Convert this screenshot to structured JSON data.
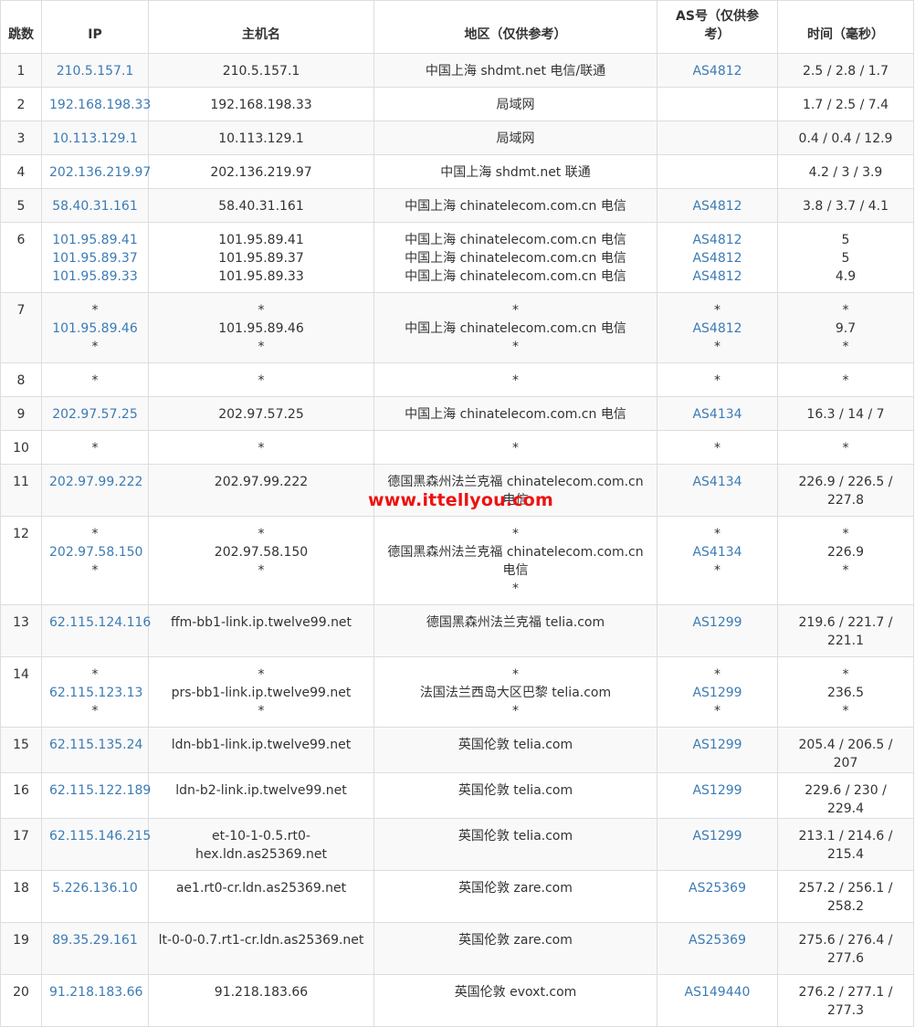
{
  "headers": {
    "hop": "跳数",
    "ip": "IP",
    "host": "主机名",
    "region": "地区（仅供参考）",
    "asn": "AS号（仅供参考）",
    "time": "时间（毫秒）"
  },
  "watermark": "www.ittellyou.com",
  "rows": [
    {
      "hop": "1",
      "ip": [
        "210.5.157.1"
      ],
      "host": [
        "210.5.157.1"
      ],
      "region": [
        "中国上海 shdmt.net 电信/联通"
      ],
      "asn": [
        "AS4812"
      ],
      "time": [
        "2.5 / 2.8 / 1.7"
      ]
    },
    {
      "hop": "2",
      "ip": [
        "192.168.198.33"
      ],
      "host": [
        "192.168.198.33"
      ],
      "region": [
        "局域网"
      ],
      "asn": [
        ""
      ],
      "time": [
        "1.7 / 2.5 / 7.4"
      ]
    },
    {
      "hop": "3",
      "ip": [
        "10.113.129.1"
      ],
      "host": [
        "10.113.129.1"
      ],
      "region": [
        "局域网"
      ],
      "asn": [
        ""
      ],
      "time": [
        "0.4 / 0.4 / 12.9"
      ]
    },
    {
      "hop": "4",
      "ip": [
        "202.136.219.97"
      ],
      "host": [
        "202.136.219.97"
      ],
      "region": [
        "中国上海 shdmt.net 联通"
      ],
      "asn": [
        ""
      ],
      "time": [
        "4.2 / 3 / 3.9"
      ]
    },
    {
      "hop": "5",
      "ip": [
        "58.40.31.161"
      ],
      "host": [
        "58.40.31.161"
      ],
      "region": [
        "中国上海 chinatelecom.com.cn 电信"
      ],
      "asn": [
        "AS4812"
      ],
      "time": [
        "3.8 / 3.7 / 4.1"
      ]
    },
    {
      "hop": "6",
      "ip": [
        "101.95.89.41",
        "101.95.89.37",
        "101.95.89.33"
      ],
      "host": [
        "101.95.89.41",
        "101.95.89.37",
        "101.95.89.33"
      ],
      "region": [
        "中国上海 chinatelecom.com.cn 电信",
        "中国上海 chinatelecom.com.cn 电信",
        "中国上海 chinatelecom.com.cn 电信"
      ],
      "asn": [
        "AS4812",
        "AS4812",
        "AS4812"
      ],
      "time": [
        "5",
        "5",
        "4.9"
      ]
    },
    {
      "hop": "7",
      "ip": [
        "*",
        "101.95.89.46",
        "*"
      ],
      "host": [
        "*",
        "101.95.89.46",
        "*"
      ],
      "region": [
        "*",
        "中国上海 chinatelecom.com.cn 电信",
        "*"
      ],
      "asn": [
        "*",
        "AS4812",
        "*"
      ],
      "time": [
        "*",
        "9.7",
        "*"
      ]
    },
    {
      "hop": "8",
      "ip": [
        "*"
      ],
      "host": [
        "*"
      ],
      "region": [
        "*"
      ],
      "asn": [
        "*"
      ],
      "time": [
        "*"
      ]
    },
    {
      "hop": "9",
      "ip": [
        "202.97.57.25"
      ],
      "host": [
        "202.97.57.25"
      ],
      "region": [
        "中国上海 chinatelecom.com.cn 电信"
      ],
      "asn": [
        "AS4134"
      ],
      "time": [
        "16.3 / 14 / 7"
      ]
    },
    {
      "hop": "10",
      "ip": [
        "*"
      ],
      "host": [
        "*"
      ],
      "region": [
        "*"
      ],
      "asn": [
        "*"
      ],
      "time": [
        "*"
      ]
    },
    {
      "hop": "11",
      "ip": [
        "202.97.99.222"
      ],
      "host": [
        "202.97.99.222"
      ],
      "region": [
        "德国黑森州法兰克福 chinatelecom.com.cn 电信"
      ],
      "asn": [
        "AS4134"
      ],
      "time": [
        "226.9 / 226.5 / 227.8"
      ]
    },
    {
      "hop": "12",
      "ip": [
        "*",
        "202.97.58.150",
        "*"
      ],
      "host": [
        "*",
        "202.97.58.150",
        "*"
      ],
      "region": [
        "*",
        "德国黑森州法兰克福 chinatelecom.com.cn 电信",
        "*"
      ],
      "asn": [
        "*",
        "AS4134",
        "*"
      ],
      "time": [
        "*",
        "226.9",
        "*"
      ]
    },
    {
      "hop": "13",
      "ip": [
        "62.115.124.116"
      ],
      "host": [
        "ffm-bb1-link.ip.twelve99.net"
      ],
      "region": [
        "德国黑森州法兰克福 telia.com"
      ],
      "asn": [
        "AS1299"
      ],
      "time": [
        "219.6 / 221.7 / 221.1"
      ]
    },
    {
      "hop": "14",
      "ip": [
        "*",
        "62.115.123.13",
        "*"
      ],
      "host": [
        "*",
        "prs-bb1-link.ip.twelve99.net",
        "*"
      ],
      "region": [
        "*",
        "法国法兰西岛大区巴黎 telia.com",
        "*"
      ],
      "asn": [
        "*",
        "AS1299",
        "*"
      ],
      "time": [
        "*",
        "236.5",
        "*"
      ]
    },
    {
      "hop": "15",
      "ip": [
        "62.115.135.24"
      ],
      "host": [
        "ldn-bb1-link.ip.twelve99.net"
      ],
      "region": [
        "英国伦敦 telia.com"
      ],
      "asn": [
        "AS1299"
      ],
      "time": [
        "205.4 / 206.5 / 207"
      ]
    },
    {
      "hop": "16",
      "ip": [
        "62.115.122.189"
      ],
      "host": [
        "ldn-b2-link.ip.twelve99.net"
      ],
      "region": [
        "英国伦敦 telia.com"
      ],
      "asn": [
        "AS1299"
      ],
      "time": [
        "229.6 / 230 / 229.4"
      ]
    },
    {
      "hop": "17",
      "ip": [
        "62.115.146.215"
      ],
      "host": [
        "et-10-1-0.5.rt0-hex.ldn.as25369.net"
      ],
      "region": [
        "英国伦敦 telia.com"
      ],
      "asn": [
        "AS1299"
      ],
      "time": [
        "213.1 / 214.6 / 215.4"
      ]
    },
    {
      "hop": "18",
      "ip": [
        "5.226.136.10"
      ],
      "host": [
        "ae1.rt0-cr.ldn.as25369.net"
      ],
      "region": [
        "英国伦敦 zare.com"
      ],
      "asn": [
        "AS25369"
      ],
      "time": [
        "257.2 / 256.1 / 258.2"
      ]
    },
    {
      "hop": "19",
      "ip": [
        "89.35.29.161"
      ],
      "host": [
        "lt-0-0-0.7.rt1-cr.ldn.as25369.net"
      ],
      "region": [
        "英国伦敦 zare.com"
      ],
      "asn": [
        "AS25369"
      ],
      "time": [
        "275.6 / 276.4 / 277.6"
      ]
    },
    {
      "hop": "20",
      "ip": [
        "91.218.183.66"
      ],
      "host": [
        "91.218.183.66"
      ],
      "region": [
        "英国伦敦 evoxt.com"
      ],
      "asn": [
        "AS149440"
      ],
      "time": [
        "276.2 / 277.1 / 277.3"
      ]
    }
  ]
}
